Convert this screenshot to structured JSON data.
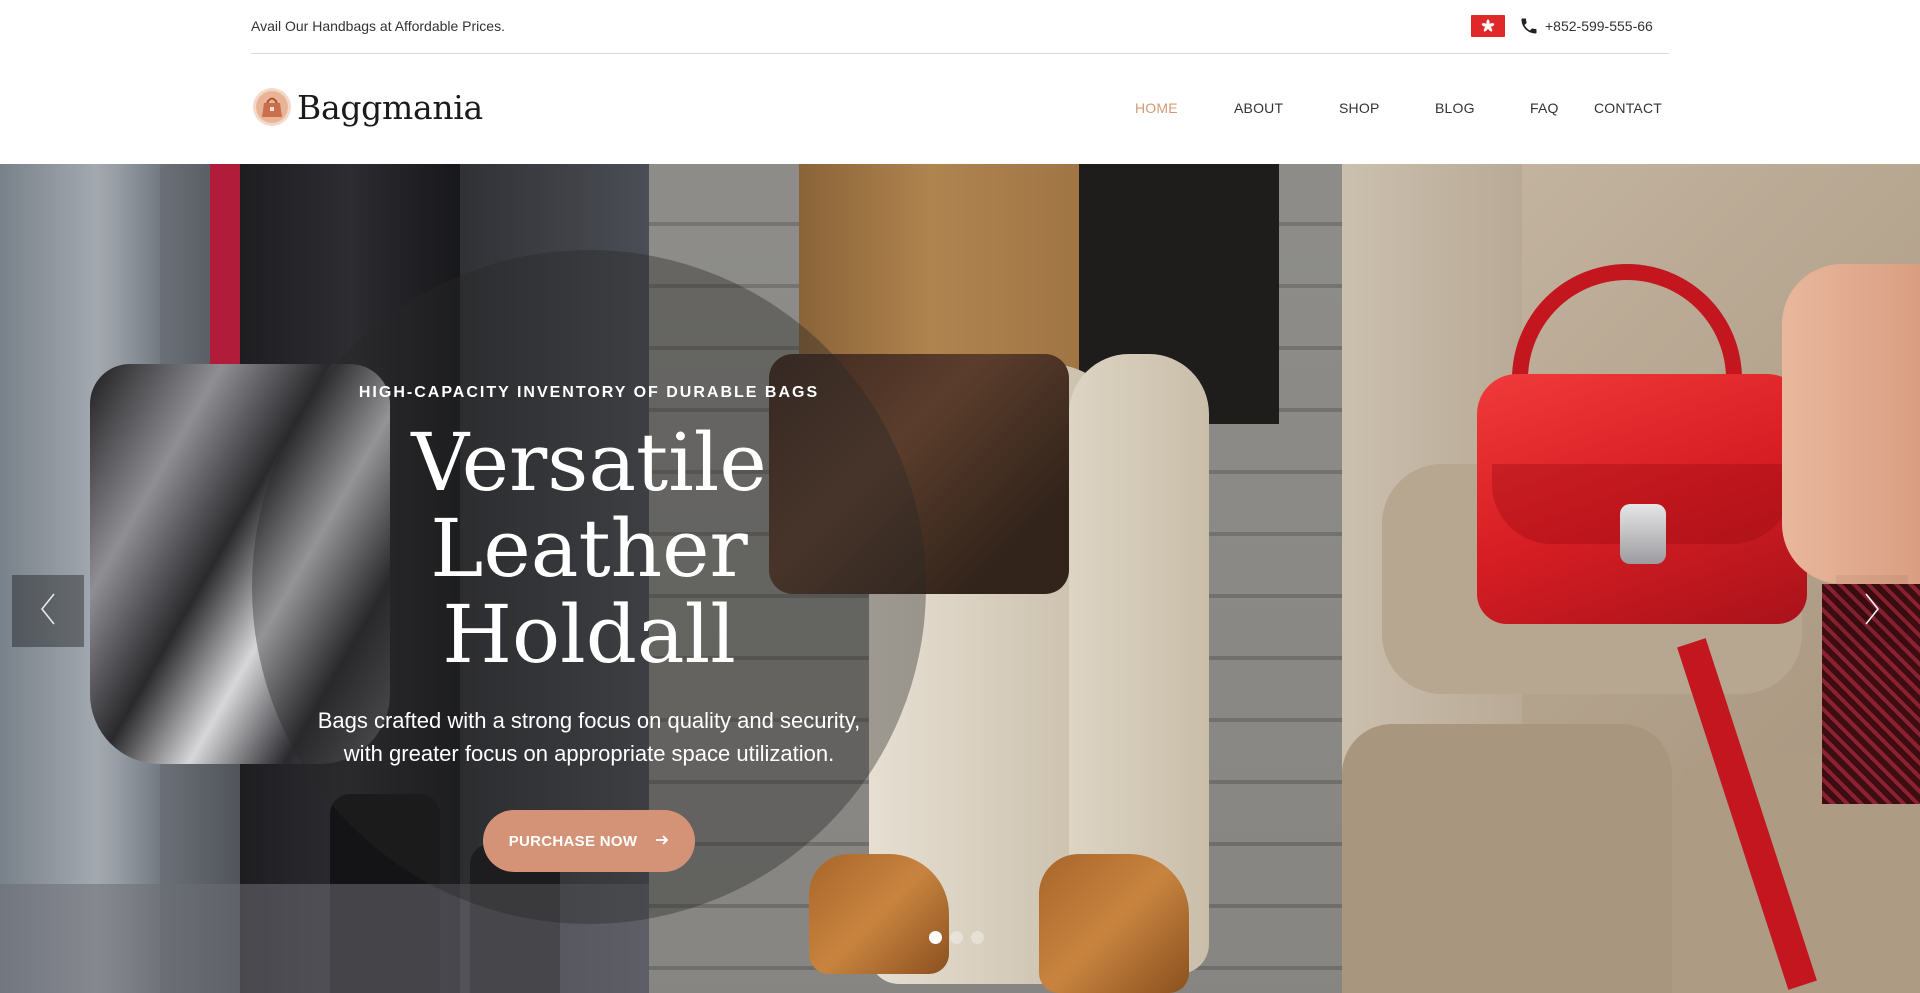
{
  "topbar": {
    "promo": "Avail Our Handbags at Affordable Prices.",
    "flag_icon": "hong-kong-flag-icon",
    "phone_icon": "phone-icon",
    "phone": "+852-599-555-66"
  },
  "header": {
    "logo_icon": "handbag-logo-icon",
    "logo_text": "Baggmania",
    "nav": {
      "home": "HOME",
      "about": "ABOUT",
      "shop": "SHOP",
      "blog": "BLOG",
      "faq": "FAQ",
      "contact": "CONTACT"
    }
  },
  "hero": {
    "eyebrow": "HIGH-CAPACITY INVENTORY OF DURABLE BAGS",
    "title_line1": "Versatile Leather",
    "title_line2": "Holdall",
    "subtitle_line1": "Bags crafted with a strong focus on quality and security,",
    "subtitle_line2": "with greater focus on appropriate space utilization.",
    "cta_label": "PURCHASE NOW",
    "cta_icon": "arrow-right-icon",
    "prev_icon": "chevron-left-icon",
    "next_icon": "chevron-right-icon",
    "active_slide": 1,
    "slide_count": 3
  },
  "colors": {
    "accent": "#d49377",
    "nav_active": "#d49a77",
    "flag_red": "#e0282b"
  }
}
